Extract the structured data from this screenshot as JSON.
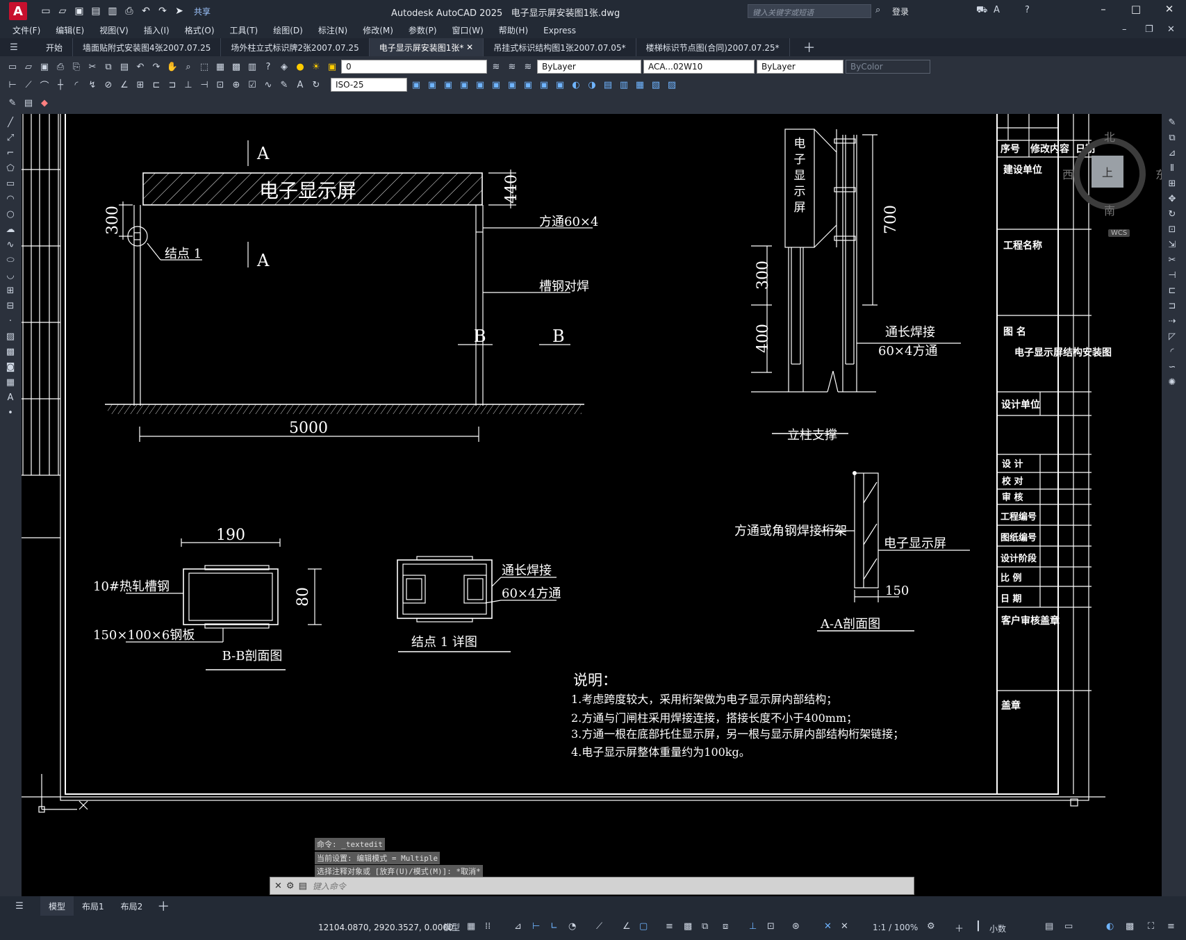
{
  "app": {
    "title": "Autodesk AutoCAD 2025",
    "file": "电子显示屏安装图1张.dwg",
    "share_label": "共享",
    "search_placeholder": "键入关键字或短语",
    "login": "登录"
  },
  "menu": [
    "文件(F)",
    "编辑(E)",
    "视图(V)",
    "插入(I)",
    "格式(O)",
    "工具(T)",
    "绘图(D)",
    "标注(N)",
    "修改(M)",
    "参数(P)",
    "窗口(W)",
    "帮助(H)",
    "Express"
  ],
  "file_tabs": [
    "开始",
    "墙面贴附式安装图4张2007.07.25",
    "场外柱立式标识牌2张2007.07.25",
    "电子显示屏安装图1张*",
    "吊挂式标识结构图1张2007.07.05*",
    "楼梯标识节点图(合同)2007.07.25*"
  ],
  "active_tab_index": 3,
  "layer": {
    "current": "0",
    "color": "ByLayer",
    "linetype": "ACA...02W10",
    "lineweight": "ByLayer",
    "plotstyle": "ByColor",
    "dimstyle": "ISO-25"
  },
  "drawing": {
    "main_screen_label": "电子显示屏",
    "dim_440": "440",
    "dim_300": "300",
    "dim_5000": "5000",
    "section_a": "A",
    "section_b": "B",
    "node1": "结点 1",
    "label_tube": "方通60×4",
    "label_channel_weld": "槽钢对焊",
    "column_title": "立柱支撑",
    "column_screen_text": "电子显示屏",
    "dim_700": "700",
    "dim_col_300": "300",
    "dim_col_400": "400",
    "label_long_weld": "通长焊接",
    "label_long_weld2": "60×4方通",
    "aa_title": "A-A剖面图",
    "aa_truss": "方通或角钢焊接桁架",
    "aa_screen": "电子显示屏",
    "aa_dim150": "150",
    "bb_title": "B-B剖面图",
    "bb_190": "190",
    "bb_80": "80",
    "bb_channel": "10#热轧槽钢",
    "bb_plate": "150×100×6钢板",
    "node_title": "结点 1 详图",
    "node_weld": "通长焊接",
    "node_tube": "60×4方通",
    "notes_title": "说明：",
    "notes": [
      "1.考虑跨度较大，采用桁架做为电子显示屏内部结构；",
      "2.方通与门闸柱采用焊接连接，搭接长度不小于400mm；",
      "3.方通一根在底部托住显示屏，另一根与显示屏内部结构桁架链接；",
      "4.电子显示屏整体重量约为100kg。"
    ]
  },
  "titleblock": {
    "seq": "序号",
    "modify": "修改内容",
    "date_col": "日期",
    "build_unit": "建设单位",
    "project_name": "工程名称",
    "drawing_name_label": "图 名",
    "drawing_name": "电子显示屏结构安装图",
    "design_unit": "设计单位",
    "rows": [
      "设 计",
      "校 对",
      "审 核",
      "工程编号",
      "图纸编号",
      "设计阶段",
      "比 例",
      "日 期"
    ],
    "client_seal": "客户审核盖章",
    "seal": "盖章"
  },
  "viewcube": {
    "north": "北",
    "south": "南",
    "east": "东",
    "west": "西",
    "top": "上",
    "wcs": "WCS"
  },
  "command": {
    "hist1": "命令: _textedit",
    "hist2": "当前设置: 编辑模式 = Multiple",
    "hist3": "选择注释对象或 [放弃(U)/模式(M)]: *取消*",
    "placeholder": "键入命令"
  },
  "layouts": [
    "模型",
    "布局1",
    "布局2"
  ],
  "status": {
    "coords": "12104.0870, 2920.3527, 0.0000",
    "space": "模型",
    "scale": "1:1 / 100%",
    "units": "小数"
  }
}
